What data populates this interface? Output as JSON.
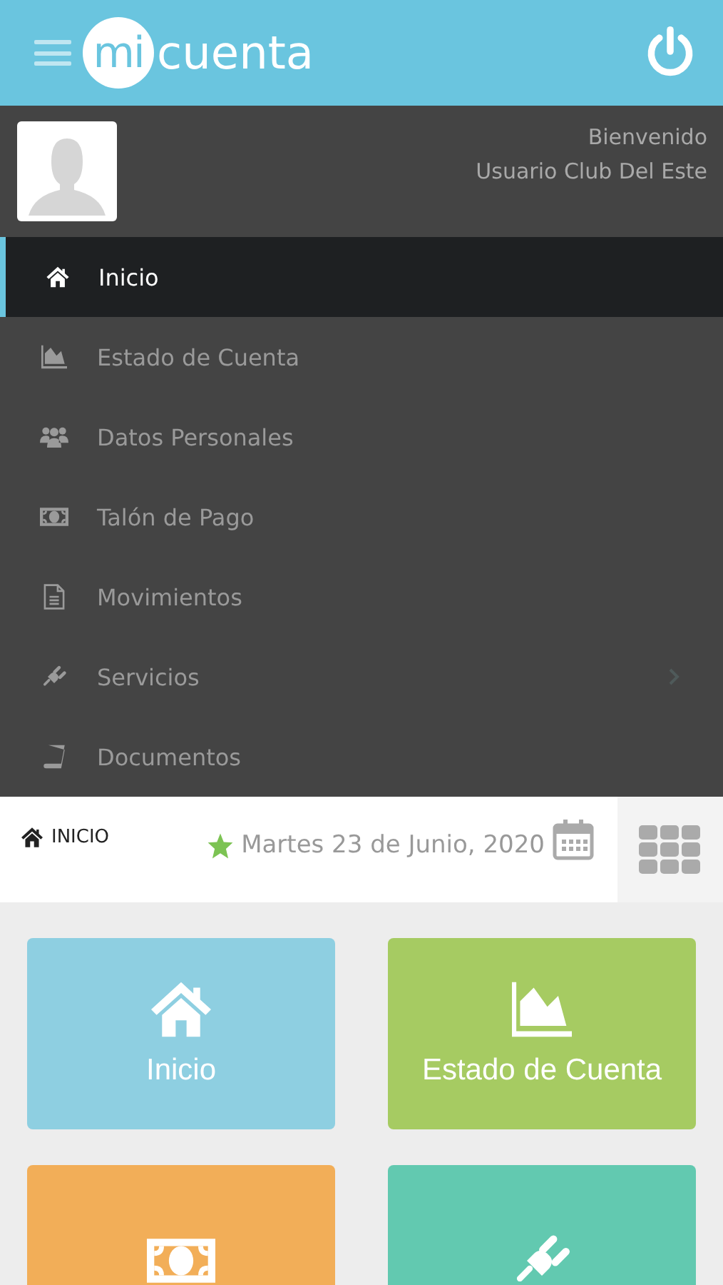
{
  "header": {
    "logo_badge": "mi",
    "logo_text": "cuenta"
  },
  "profile": {
    "greeting": "Bienvenido",
    "user": "Usuario Club Del Este"
  },
  "menu": [
    {
      "label": "Inicio",
      "selected": true,
      "submenu": false
    },
    {
      "label": "Estado de Cuenta",
      "selected": false,
      "submenu": false
    },
    {
      "label": "Datos Personales",
      "selected": false,
      "submenu": false
    },
    {
      "label": "Talón de Pago",
      "selected": false,
      "submenu": false
    },
    {
      "label": "Movimientos",
      "selected": false,
      "submenu": false
    },
    {
      "label": "Servicios",
      "selected": false,
      "submenu": true
    },
    {
      "label": "Documentos",
      "selected": false,
      "submenu": false
    }
  ],
  "breadcrumb": {
    "label": "INICIO",
    "date": "Martes 23 de Junio, 2020"
  },
  "tiles": [
    {
      "label": "Inicio",
      "color": "#8ecfe1"
    },
    {
      "label": "Estado de Cuenta",
      "color": "#a6cb62"
    },
    {
      "color": "#f2ae58"
    },
    {
      "color": "#62c9b0"
    }
  ]
}
